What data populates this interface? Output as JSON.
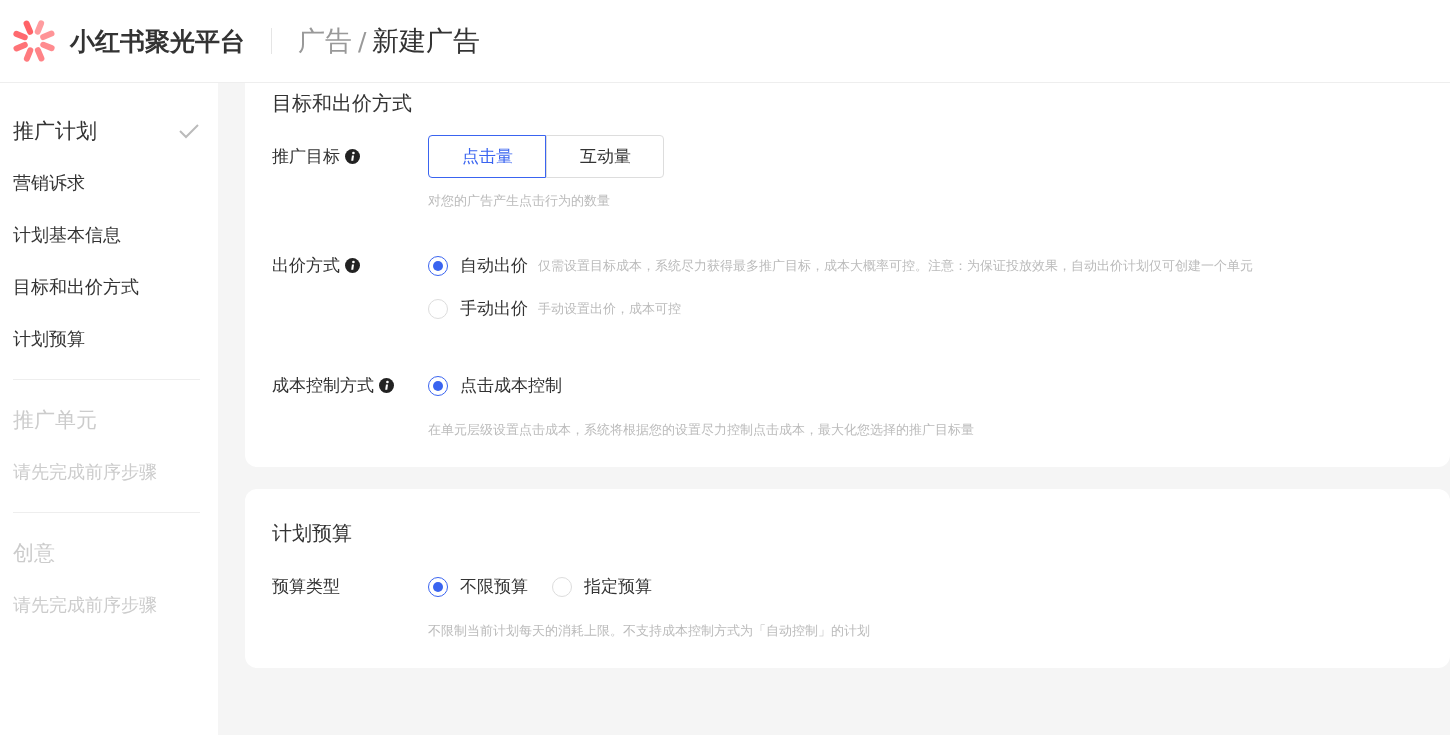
{
  "header": {
    "brand": "小红书聚光平台",
    "breadcrumb": [
      {
        "text": "广告",
        "current": false
      },
      {
        "text": "新建广告",
        "current": true
      }
    ],
    "separator": "/"
  },
  "sidebar": {
    "sections": [
      {
        "title": "推广计划",
        "disabled": false,
        "completed": true,
        "items": [
          {
            "label": "营销诉求"
          },
          {
            "label": "计划基本信息"
          },
          {
            "label": "目标和出价方式"
          },
          {
            "label": "计划预算"
          }
        ]
      },
      {
        "title": "推广单元",
        "disabled": true,
        "completed": false,
        "hint": "请先完成前序步骤"
      },
      {
        "title": "创意",
        "disabled": true,
        "completed": false,
        "hint": "请先完成前序步骤"
      }
    ]
  },
  "cards": [
    {
      "title": "目标和出价方式",
      "fields": [
        {
          "kind": "segmented",
          "label": "推广目标",
          "info": true,
          "options": [
            {
              "label": "点击量",
              "selected": true
            },
            {
              "label": "互动量",
              "selected": false
            }
          ],
          "hint": "对您的广告产生点击行为的数量"
        },
        {
          "kind": "radio-column",
          "label": "出价方式",
          "info": true,
          "options": [
            {
              "label": "自动出价",
              "selected": true,
              "description": "仅需设置目标成本，系统尽力获得最多推广目标，成本大概率可控。注意：为保证投放效果，自动出价计划仅可创建一个单元"
            },
            {
              "label": "手动出价",
              "selected": false,
              "description": "手动设置出价，成本可控"
            }
          ]
        },
        {
          "kind": "radio-column",
          "label": "成本控制方式",
          "info": true,
          "options": [
            {
              "label": "点击成本控制",
              "selected": true
            }
          ],
          "hint": "在单元层级设置点击成本，系统将根据您的设置尽力控制点击成本，最大化您选择的推广目标量"
        }
      ]
    },
    {
      "title": "计划预算",
      "fields": [
        {
          "kind": "radio-row",
          "label": "预算类型",
          "info": false,
          "options": [
            {
              "label": "不限预算",
              "selected": true
            },
            {
              "label": "指定预算",
              "selected": false
            }
          ],
          "hint": "不限制当前计划每天的消耗上限。不支持成本控制方式为「自动控制」的计划"
        }
      ]
    }
  ]
}
